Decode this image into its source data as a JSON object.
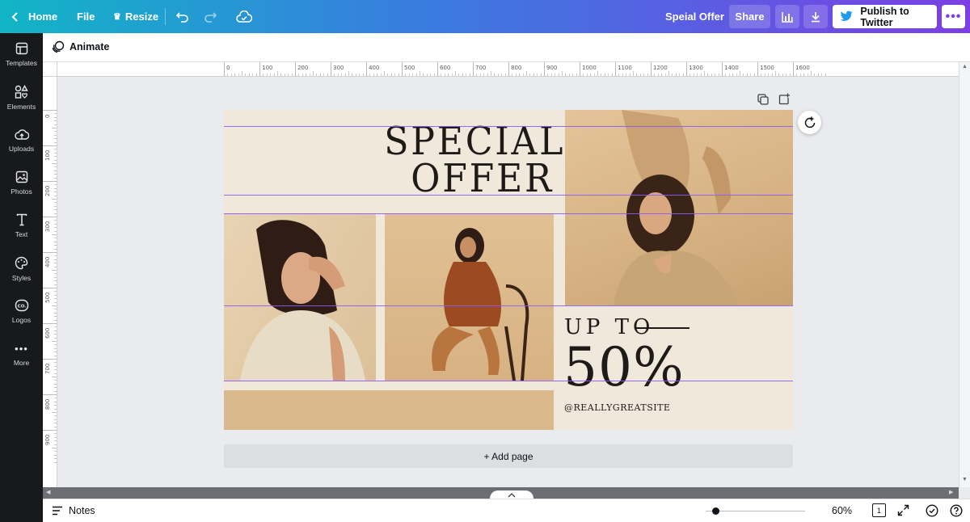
{
  "topbar": {
    "home": "Home",
    "file": "File",
    "resize": "Resize",
    "doc_title": "Speial Offer",
    "share": "Share",
    "publish": "Publish to Twitter"
  },
  "sidebar": {
    "items": [
      {
        "label": "Templates",
        "icon": "templates-icon"
      },
      {
        "label": "Elements",
        "icon": "elements-icon"
      },
      {
        "label": "Uploads",
        "icon": "uploads-icon"
      },
      {
        "label": "Photos",
        "icon": "photos-icon"
      },
      {
        "label": "Text",
        "icon": "text-icon"
      },
      {
        "label": "Styles",
        "icon": "styles-icon"
      },
      {
        "label": "Logos",
        "icon": "logos-icon"
      },
      {
        "label": "More",
        "icon": "more-icon"
      }
    ]
  },
  "toolbar": {
    "animate": "Animate"
  },
  "ruler": {
    "h": [
      "0",
      "100",
      "200",
      "300",
      "400",
      "500",
      "600",
      "700",
      "800",
      "900",
      "1000",
      "1100",
      "1200",
      "1300",
      "1400",
      "1500",
      "1600"
    ],
    "v": [
      "0",
      "100",
      "200",
      "300",
      "400",
      "500",
      "600",
      "700",
      "800",
      "900"
    ]
  },
  "design": {
    "title_line1": "SPECIAL",
    "title_line2": "OFFER",
    "up_to": "UP TO",
    "percent": "50%",
    "website": "@REALLYGREATSITE",
    "bg_color": "#f1e8dc",
    "tan_color": "#d9b98c"
  },
  "canvas": {
    "add_page": "+ Add page"
  },
  "bottombar": {
    "notes": "Notes",
    "zoom": "60%",
    "page_count": "1"
  }
}
